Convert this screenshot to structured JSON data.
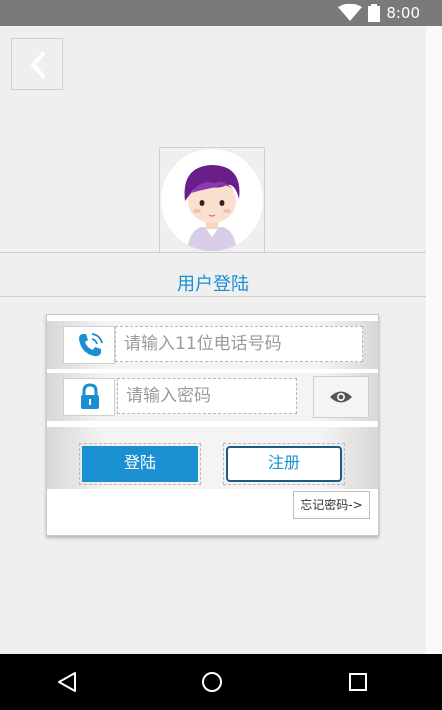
{
  "status_bar": {
    "time": "8:00"
  },
  "header": {
    "title": "用户登陆"
  },
  "form": {
    "phone_placeholder": "请输入11位电话号码",
    "password_placeholder": "请输入密码",
    "login_label": "登陆",
    "register_label": "注册",
    "forgot_label": "忘记密码->"
  },
  "colors": {
    "accent": "#1a8fd1",
    "register_border": "#1f5a82",
    "status_bar": "#7a7a7a"
  },
  "icons": [
    "wifi-icon",
    "battery-icon",
    "back-arrow-icon",
    "avatar-image",
    "phone-icon",
    "lock-icon",
    "eye-icon",
    "nav-back-icon",
    "nav-home-icon",
    "nav-recents-icon"
  ]
}
